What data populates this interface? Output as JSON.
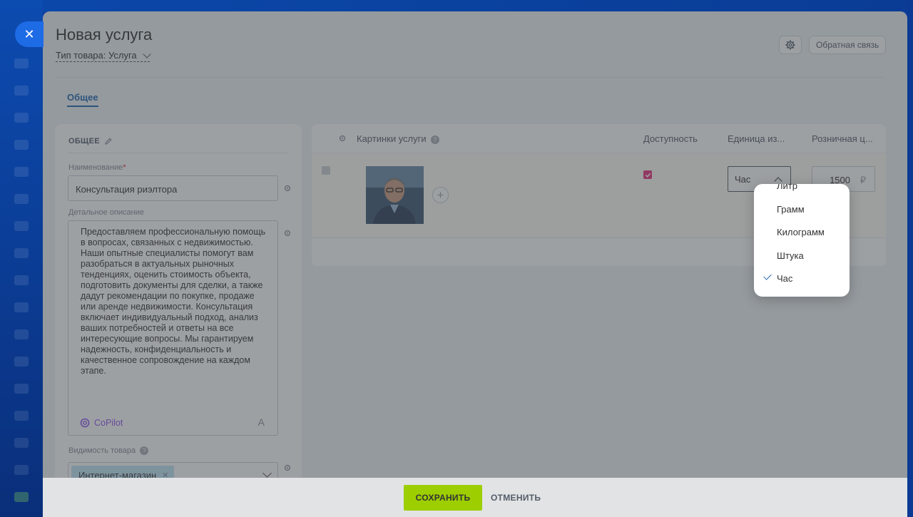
{
  "window": {
    "close_symbol": "✕"
  },
  "header": {
    "title": "Новая услуга",
    "product_type": "Тип товара: Услуга",
    "feedback_label": "Обратная связь"
  },
  "tabs": [
    {
      "label": "Общее",
      "active": true
    }
  ],
  "left_panel": {
    "section_title": "ОБЩЕЕ",
    "name_label": "Наименование",
    "required_mark": "*",
    "name_value": "Консультация риэлтора",
    "description_label": "Детальное описание",
    "description_value": "Предоставляем профессиональную помощь в вопросах, связанных с недвижимостью. Наши опытные специалисты помогут вам разобраться в актуальных рыночных тенденциях, оценить стоимость объекта, подготовить документы для сделки, а также дадут рекомендации по покупке, продаже или аренде недвижимости. Консультация включает индивидуальный подход, анализ ваших потребностей и ответы на все интересующие вопросы. Мы гарантируем надежность, конфиденциальность и качественное сопровождение на каждом этапе.",
    "copilot_label": "CoPilot",
    "format_icon_label": "A",
    "visibility_label": "Видимость товара",
    "visibility_tag": "Интернет-магазин"
  },
  "grid": {
    "columns": {
      "images": "Картинки услуги",
      "availability": "Доступность",
      "unit": "Единица из...",
      "price": "Розничная ц..."
    },
    "row": {
      "selected": true,
      "available": true,
      "unit": "Час",
      "price": "1500",
      "currency": "₽"
    }
  },
  "unit_dropdown": {
    "items": [
      {
        "label": "Литр",
        "selected": false
      },
      {
        "label": "Грамм",
        "selected": false
      },
      {
        "label": "Килограмм",
        "selected": false
      },
      {
        "label": "Штука",
        "selected": false
      },
      {
        "label": "Час",
        "selected": true
      }
    ]
  },
  "footer": {
    "save_label": "СОХРАНИТЬ",
    "cancel_label": "ОТМЕНИТЬ"
  },
  "colors": {
    "accent_blue": "#2067b0",
    "save_green": "#9dcf00",
    "checkbox_pink": "#e8317e",
    "copilot_purple": "#8e52ec"
  }
}
